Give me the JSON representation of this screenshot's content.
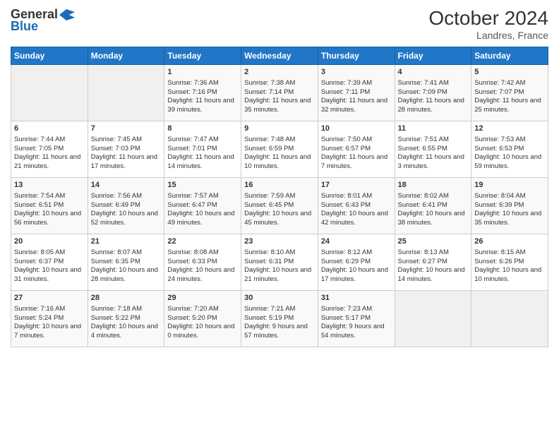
{
  "header": {
    "logo_general": "General",
    "logo_blue": "Blue",
    "month": "October 2024",
    "location": "Landres, France"
  },
  "days_of_week": [
    "Sunday",
    "Monday",
    "Tuesday",
    "Wednesday",
    "Thursday",
    "Friday",
    "Saturday"
  ],
  "weeks": [
    [
      {
        "day": "",
        "sunrise": "",
        "sunset": "",
        "daylight": ""
      },
      {
        "day": "",
        "sunrise": "",
        "sunset": "",
        "daylight": ""
      },
      {
        "day": "1",
        "sunrise": "Sunrise: 7:36 AM",
        "sunset": "Sunset: 7:16 PM",
        "daylight": "Daylight: 11 hours and 39 minutes."
      },
      {
        "day": "2",
        "sunrise": "Sunrise: 7:38 AM",
        "sunset": "Sunset: 7:14 PM",
        "daylight": "Daylight: 11 hours and 35 minutes."
      },
      {
        "day": "3",
        "sunrise": "Sunrise: 7:39 AM",
        "sunset": "Sunset: 7:11 PM",
        "daylight": "Daylight: 11 hours and 32 minutes."
      },
      {
        "day": "4",
        "sunrise": "Sunrise: 7:41 AM",
        "sunset": "Sunset: 7:09 PM",
        "daylight": "Daylight: 11 hours and 28 minutes."
      },
      {
        "day": "5",
        "sunrise": "Sunrise: 7:42 AM",
        "sunset": "Sunset: 7:07 PM",
        "daylight": "Daylight: 11 hours and 25 minutes."
      }
    ],
    [
      {
        "day": "6",
        "sunrise": "Sunrise: 7:44 AM",
        "sunset": "Sunset: 7:05 PM",
        "daylight": "Daylight: 11 hours and 21 minutes."
      },
      {
        "day": "7",
        "sunrise": "Sunrise: 7:45 AM",
        "sunset": "Sunset: 7:03 PM",
        "daylight": "Daylight: 11 hours and 17 minutes."
      },
      {
        "day": "8",
        "sunrise": "Sunrise: 7:47 AM",
        "sunset": "Sunset: 7:01 PM",
        "daylight": "Daylight: 11 hours and 14 minutes."
      },
      {
        "day": "9",
        "sunrise": "Sunrise: 7:48 AM",
        "sunset": "Sunset: 6:59 PM",
        "daylight": "Daylight: 11 hours and 10 minutes."
      },
      {
        "day": "10",
        "sunrise": "Sunrise: 7:50 AM",
        "sunset": "Sunset: 6:57 PM",
        "daylight": "Daylight: 11 hours and 7 minutes."
      },
      {
        "day": "11",
        "sunrise": "Sunrise: 7:51 AM",
        "sunset": "Sunset: 6:55 PM",
        "daylight": "Daylight: 11 hours and 3 minutes."
      },
      {
        "day": "12",
        "sunrise": "Sunrise: 7:53 AM",
        "sunset": "Sunset: 6:53 PM",
        "daylight": "Daylight: 10 hours and 59 minutes."
      }
    ],
    [
      {
        "day": "13",
        "sunrise": "Sunrise: 7:54 AM",
        "sunset": "Sunset: 6:51 PM",
        "daylight": "Daylight: 10 hours and 56 minutes."
      },
      {
        "day": "14",
        "sunrise": "Sunrise: 7:56 AM",
        "sunset": "Sunset: 6:49 PM",
        "daylight": "Daylight: 10 hours and 52 minutes."
      },
      {
        "day": "15",
        "sunrise": "Sunrise: 7:57 AM",
        "sunset": "Sunset: 6:47 PM",
        "daylight": "Daylight: 10 hours and 49 minutes."
      },
      {
        "day": "16",
        "sunrise": "Sunrise: 7:59 AM",
        "sunset": "Sunset: 6:45 PM",
        "daylight": "Daylight: 10 hours and 45 minutes."
      },
      {
        "day": "17",
        "sunrise": "Sunrise: 8:01 AM",
        "sunset": "Sunset: 6:43 PM",
        "daylight": "Daylight: 10 hours and 42 minutes."
      },
      {
        "day": "18",
        "sunrise": "Sunrise: 8:02 AM",
        "sunset": "Sunset: 6:41 PM",
        "daylight": "Daylight: 10 hours and 38 minutes."
      },
      {
        "day": "19",
        "sunrise": "Sunrise: 8:04 AM",
        "sunset": "Sunset: 6:39 PM",
        "daylight": "Daylight: 10 hours and 35 minutes."
      }
    ],
    [
      {
        "day": "20",
        "sunrise": "Sunrise: 8:05 AM",
        "sunset": "Sunset: 6:37 PM",
        "daylight": "Daylight: 10 hours and 31 minutes."
      },
      {
        "day": "21",
        "sunrise": "Sunrise: 8:07 AM",
        "sunset": "Sunset: 6:35 PM",
        "daylight": "Daylight: 10 hours and 28 minutes."
      },
      {
        "day": "22",
        "sunrise": "Sunrise: 8:08 AM",
        "sunset": "Sunset: 6:33 PM",
        "daylight": "Daylight: 10 hours and 24 minutes."
      },
      {
        "day": "23",
        "sunrise": "Sunrise: 8:10 AM",
        "sunset": "Sunset: 6:31 PM",
        "daylight": "Daylight: 10 hours and 21 minutes."
      },
      {
        "day": "24",
        "sunrise": "Sunrise: 8:12 AM",
        "sunset": "Sunset: 6:29 PM",
        "daylight": "Daylight: 10 hours and 17 minutes."
      },
      {
        "day": "25",
        "sunrise": "Sunrise: 8:13 AM",
        "sunset": "Sunset: 6:27 PM",
        "daylight": "Daylight: 10 hours and 14 minutes."
      },
      {
        "day": "26",
        "sunrise": "Sunrise: 8:15 AM",
        "sunset": "Sunset: 6:26 PM",
        "daylight": "Daylight: 10 hours and 10 minutes."
      }
    ],
    [
      {
        "day": "27",
        "sunrise": "Sunrise: 7:16 AM",
        "sunset": "Sunset: 5:24 PM",
        "daylight": "Daylight: 10 hours and 7 minutes."
      },
      {
        "day": "28",
        "sunrise": "Sunrise: 7:18 AM",
        "sunset": "Sunset: 5:22 PM",
        "daylight": "Daylight: 10 hours and 4 minutes."
      },
      {
        "day": "29",
        "sunrise": "Sunrise: 7:20 AM",
        "sunset": "Sunset: 5:20 PM",
        "daylight": "Daylight: 10 hours and 0 minutes."
      },
      {
        "day": "30",
        "sunrise": "Sunrise: 7:21 AM",
        "sunset": "Sunset: 5:19 PM",
        "daylight": "Daylight: 9 hours and 57 minutes."
      },
      {
        "day": "31",
        "sunrise": "Sunrise: 7:23 AM",
        "sunset": "Sunset: 5:17 PM",
        "daylight": "Daylight: 9 hours and 54 minutes."
      },
      {
        "day": "",
        "sunrise": "",
        "sunset": "",
        "daylight": ""
      },
      {
        "day": "",
        "sunrise": "",
        "sunset": "",
        "daylight": ""
      }
    ]
  ]
}
